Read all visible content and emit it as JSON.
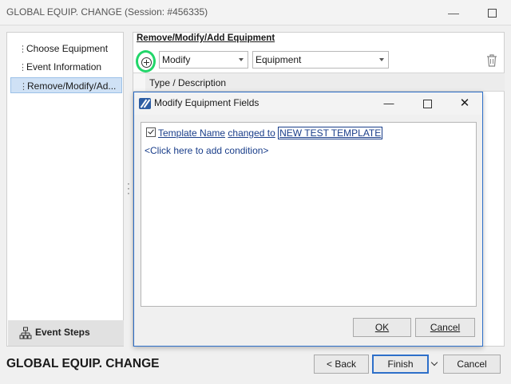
{
  "window": {
    "title": "GLOBAL EQUIP. CHANGE (Session: #456335)"
  },
  "steps": {
    "items": [
      {
        "label": "Choose Equipment"
      },
      {
        "label": "Event Information"
      },
      {
        "label": "Remove/Modify/Ad..."
      }
    ],
    "selected_index": 2,
    "footer_label": "Event Steps"
  },
  "panel": {
    "section_title": "Remove/Modify/Add Equipment",
    "action_value": "Modify",
    "target_value": "Equipment",
    "column_header": "Type / Description"
  },
  "dialog": {
    "title": "Modify Equipment Fields",
    "condition": {
      "checked": true,
      "field": "Template Name",
      "operator": "changed to",
      "value": "NEW TEST TEMPLATE"
    },
    "add_condition": "<Click here to add condition>",
    "ok_label": "OK",
    "cancel_label": "Cancel"
  },
  "footer": {
    "wizard_title": "GLOBAL EQUIP. CHANGE",
    "back_label": "< Back",
    "finish_label": "Finish",
    "cancel_label": "Cancel"
  },
  "icons": {
    "accent": "#2d6fc9",
    "highlight": "#22d66a"
  }
}
